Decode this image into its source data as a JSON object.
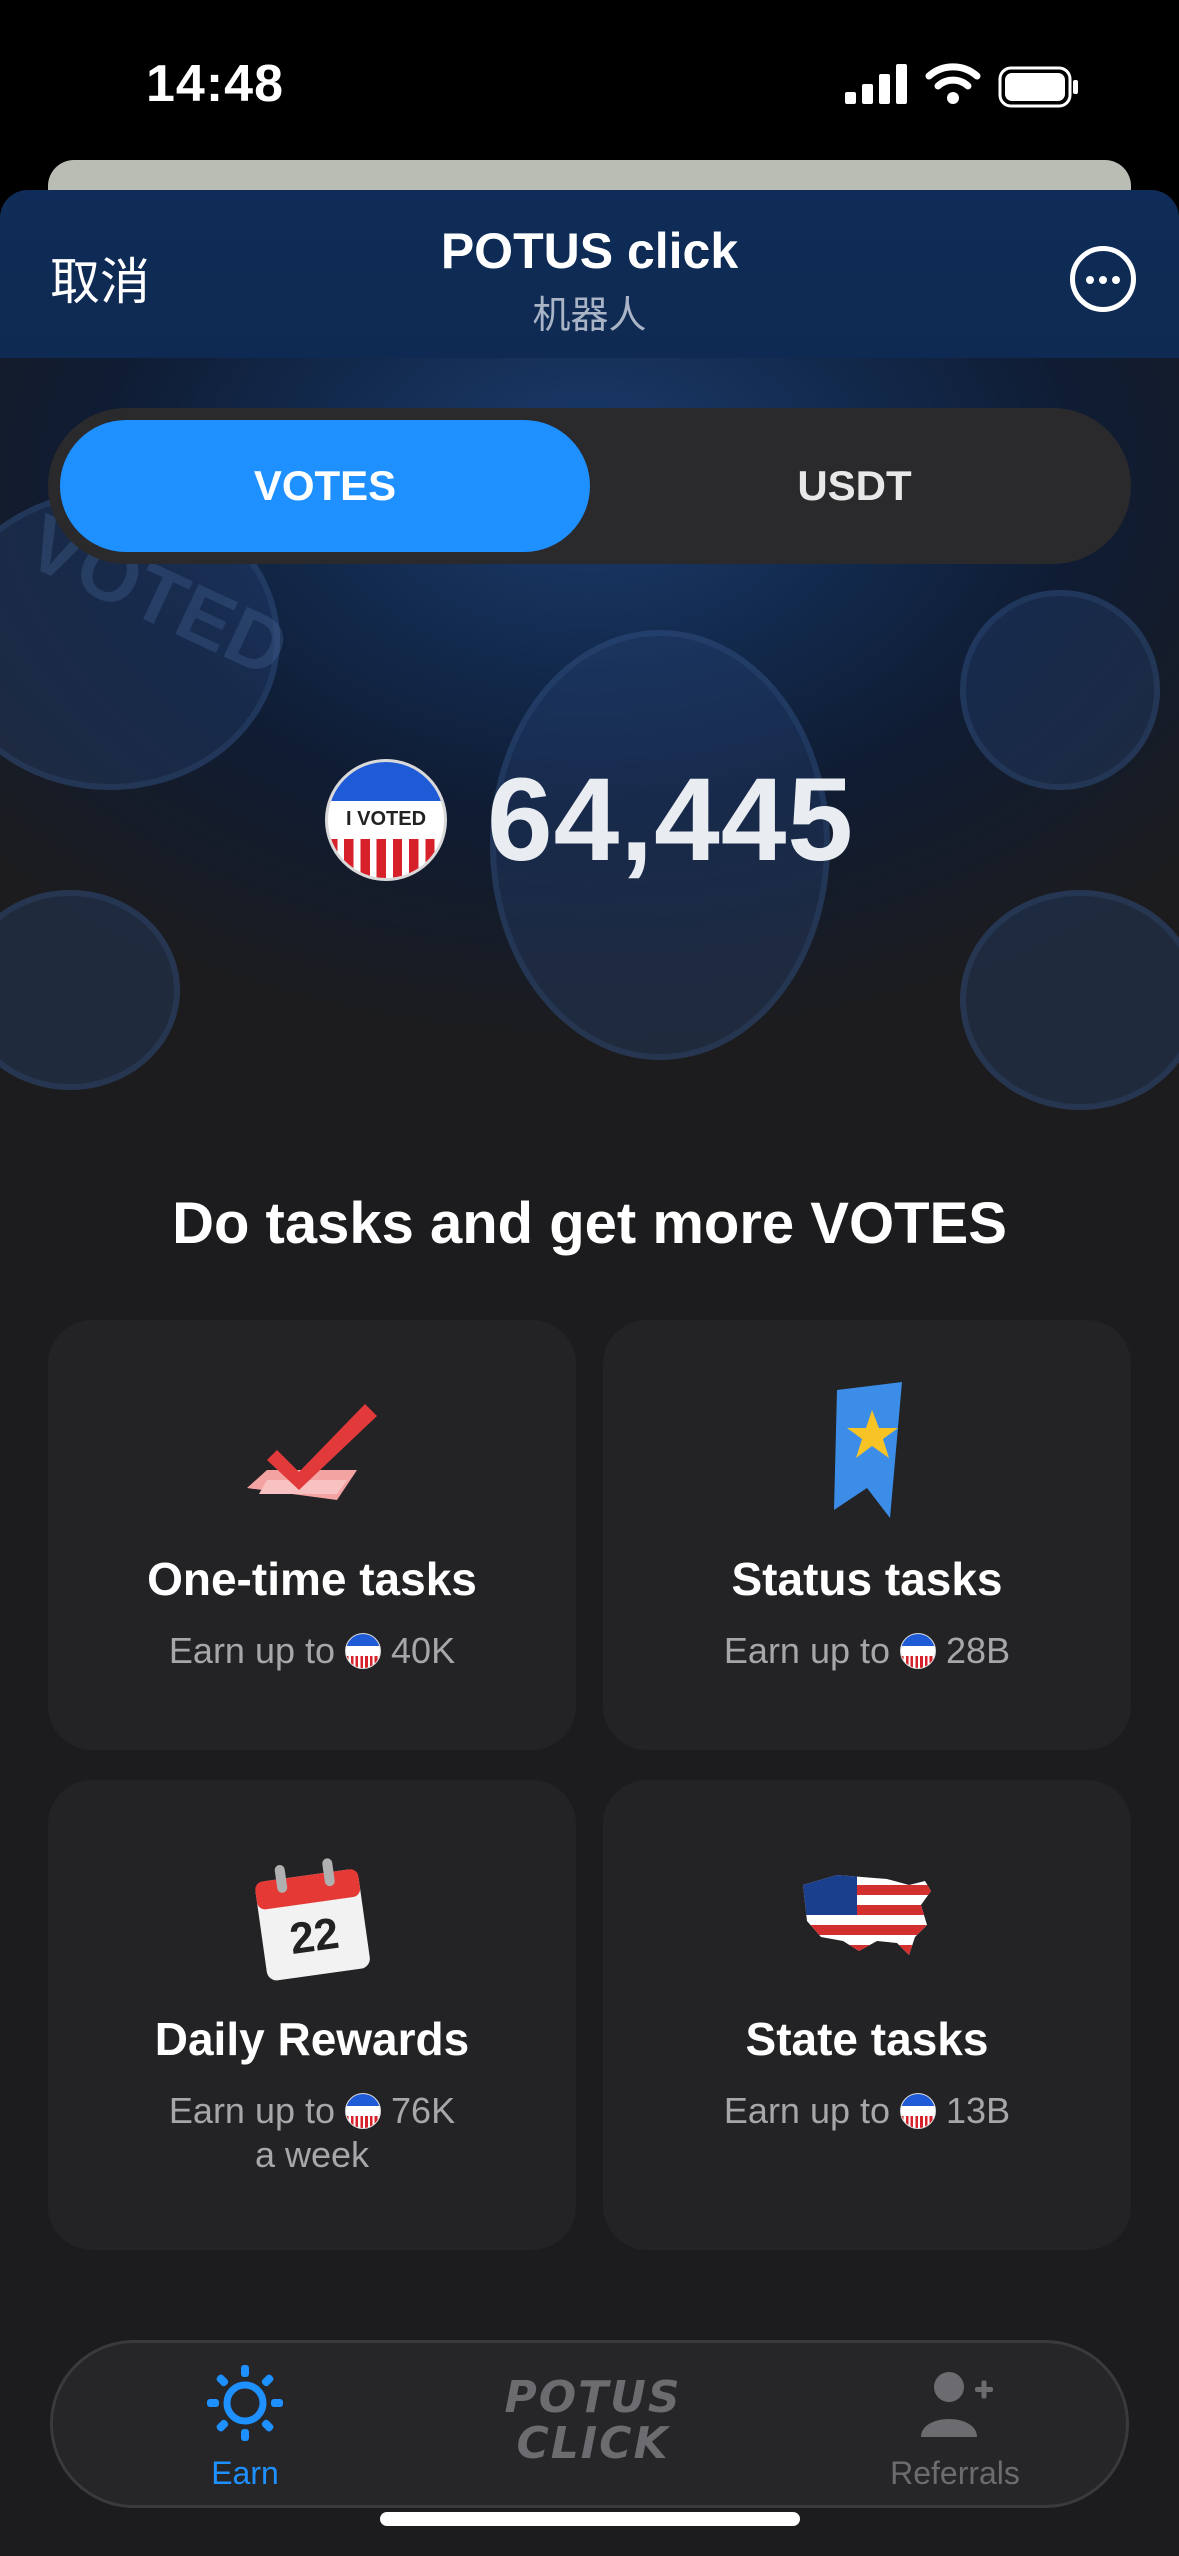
{
  "status_bar": {
    "time": "14:48"
  },
  "nav": {
    "cancel": "取消",
    "title": "POTUS click",
    "subtitle": "机器人"
  },
  "segmented": {
    "tabs": [
      {
        "label": "VOTES",
        "active": true
      },
      {
        "label": "USDT",
        "active": false
      }
    ]
  },
  "balance": {
    "value": "64,445",
    "sticker_text": "I VOTED"
  },
  "tasks": {
    "heading": "Do tasks and get more VOTES",
    "items": [
      {
        "title": "One-time tasks",
        "earn_prefix": "Earn up to",
        "amount": "40K",
        "suffix": "",
        "icon": "checkmark-icon"
      },
      {
        "title": "Status tasks",
        "earn_prefix": "Earn up to",
        "amount": "28B",
        "suffix": "",
        "icon": "star-bookmark-icon"
      },
      {
        "title": "Daily Rewards",
        "earn_prefix": "Earn up to",
        "amount": "76K",
        "suffix": "a week",
        "icon": "calendar-icon",
        "calendar_day": "22"
      },
      {
        "title": "State tasks",
        "earn_prefix": "Earn up to",
        "amount": "13B",
        "suffix": "",
        "icon": "usa-map-icon"
      }
    ]
  },
  "bottom_nav": {
    "items": [
      {
        "label": "Earn",
        "active": true
      },
      {
        "label": "Referrals",
        "active": false
      }
    ],
    "logo_line1": "POTUS",
    "logo_line2": "CLICK"
  },
  "colors": {
    "accent": "#1e90ff",
    "card": "#232325",
    "background": "#1c1c1e",
    "nav": "#0f2a52"
  }
}
